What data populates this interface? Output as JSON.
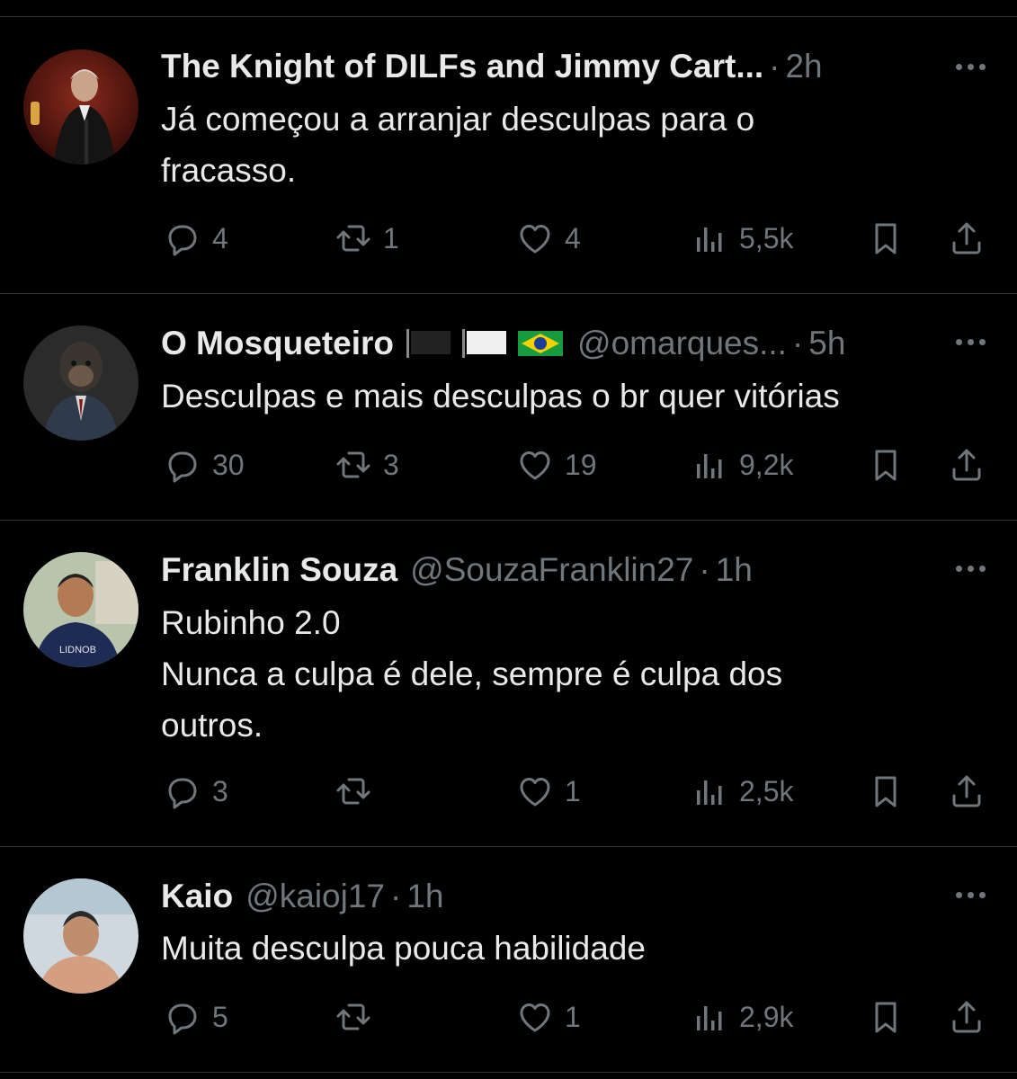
{
  "tweets": [
    {
      "name": "The Knight of DILFs and Jimmy Cart...",
      "handle": "",
      "dot": "·",
      "time": "2h",
      "lines": [
        "Já começou a arranjar desculpas para o",
        "fracasso."
      ],
      "replies": "4",
      "retweets": "1",
      "likes": "4",
      "views": "5,5k"
    },
    {
      "name": "O Mosqueteiro",
      "handle": "@omarques...",
      "dot": "·",
      "time": "5h",
      "lines": [
        "Desculpas e mais desculpas o br quer vitórias"
      ],
      "replies": "30",
      "retweets": "3",
      "likes": "19",
      "views": "9,2k"
    },
    {
      "name": "Franklin Souza",
      "handle": "@SouzaFranklin27",
      "dot": "·",
      "time": "1h",
      "lines": [
        "Rubinho 2.0",
        "Nunca a culpa é dele, sempre é culpa dos",
        "outros."
      ],
      "replies": "3",
      "retweets": "",
      "likes": "1",
      "views": "2,5k"
    },
    {
      "name": "Kaio",
      "handle": "@kaioj17",
      "dot": "·",
      "time": "1h",
      "lines": [
        "Muita desculpa pouca habilidade"
      ],
      "replies": "5",
      "retweets": "",
      "likes": "1",
      "views": "2,9k"
    }
  ],
  "colors": {
    "background": "#000000",
    "text": "#e7e9ea",
    "muted": "#71767b",
    "divider": "#2f3336"
  },
  "icons": [
    "reply-icon",
    "retweet-icon",
    "like-icon",
    "views-icon",
    "bookmark-icon",
    "share-icon",
    "more-icon"
  ]
}
